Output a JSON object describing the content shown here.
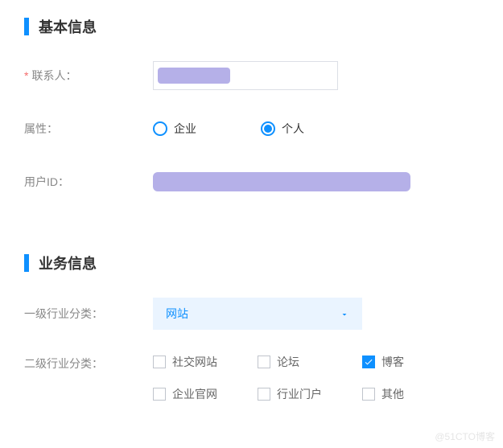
{
  "sections": {
    "basic": {
      "title": "基本信息",
      "fields": {
        "contact": {
          "label": "联系人：",
          "required": true
        },
        "attribute": {
          "label": "属性：",
          "options": {
            "enterprise": "企业",
            "personal": "个人"
          },
          "selected": "personal"
        },
        "userId": {
          "label": "用户ID："
        }
      }
    },
    "business": {
      "title": "业务信息",
      "fields": {
        "primaryCategory": {
          "label": "一级行业分类：",
          "value": "网站"
        },
        "secondaryCategory": {
          "label": "二级行业分类：",
          "options": {
            "social": {
              "label": "社交网站",
              "checked": false
            },
            "forum": {
              "label": "论坛",
              "checked": false
            },
            "blog": {
              "label": "博客",
              "checked": true
            },
            "official": {
              "label": "企业官网",
              "checked": false
            },
            "portal": {
              "label": "行业门户",
              "checked": false
            },
            "other": {
              "label": "其他",
              "checked": false
            }
          }
        }
      }
    }
  },
  "watermark": "@51CTO博客"
}
